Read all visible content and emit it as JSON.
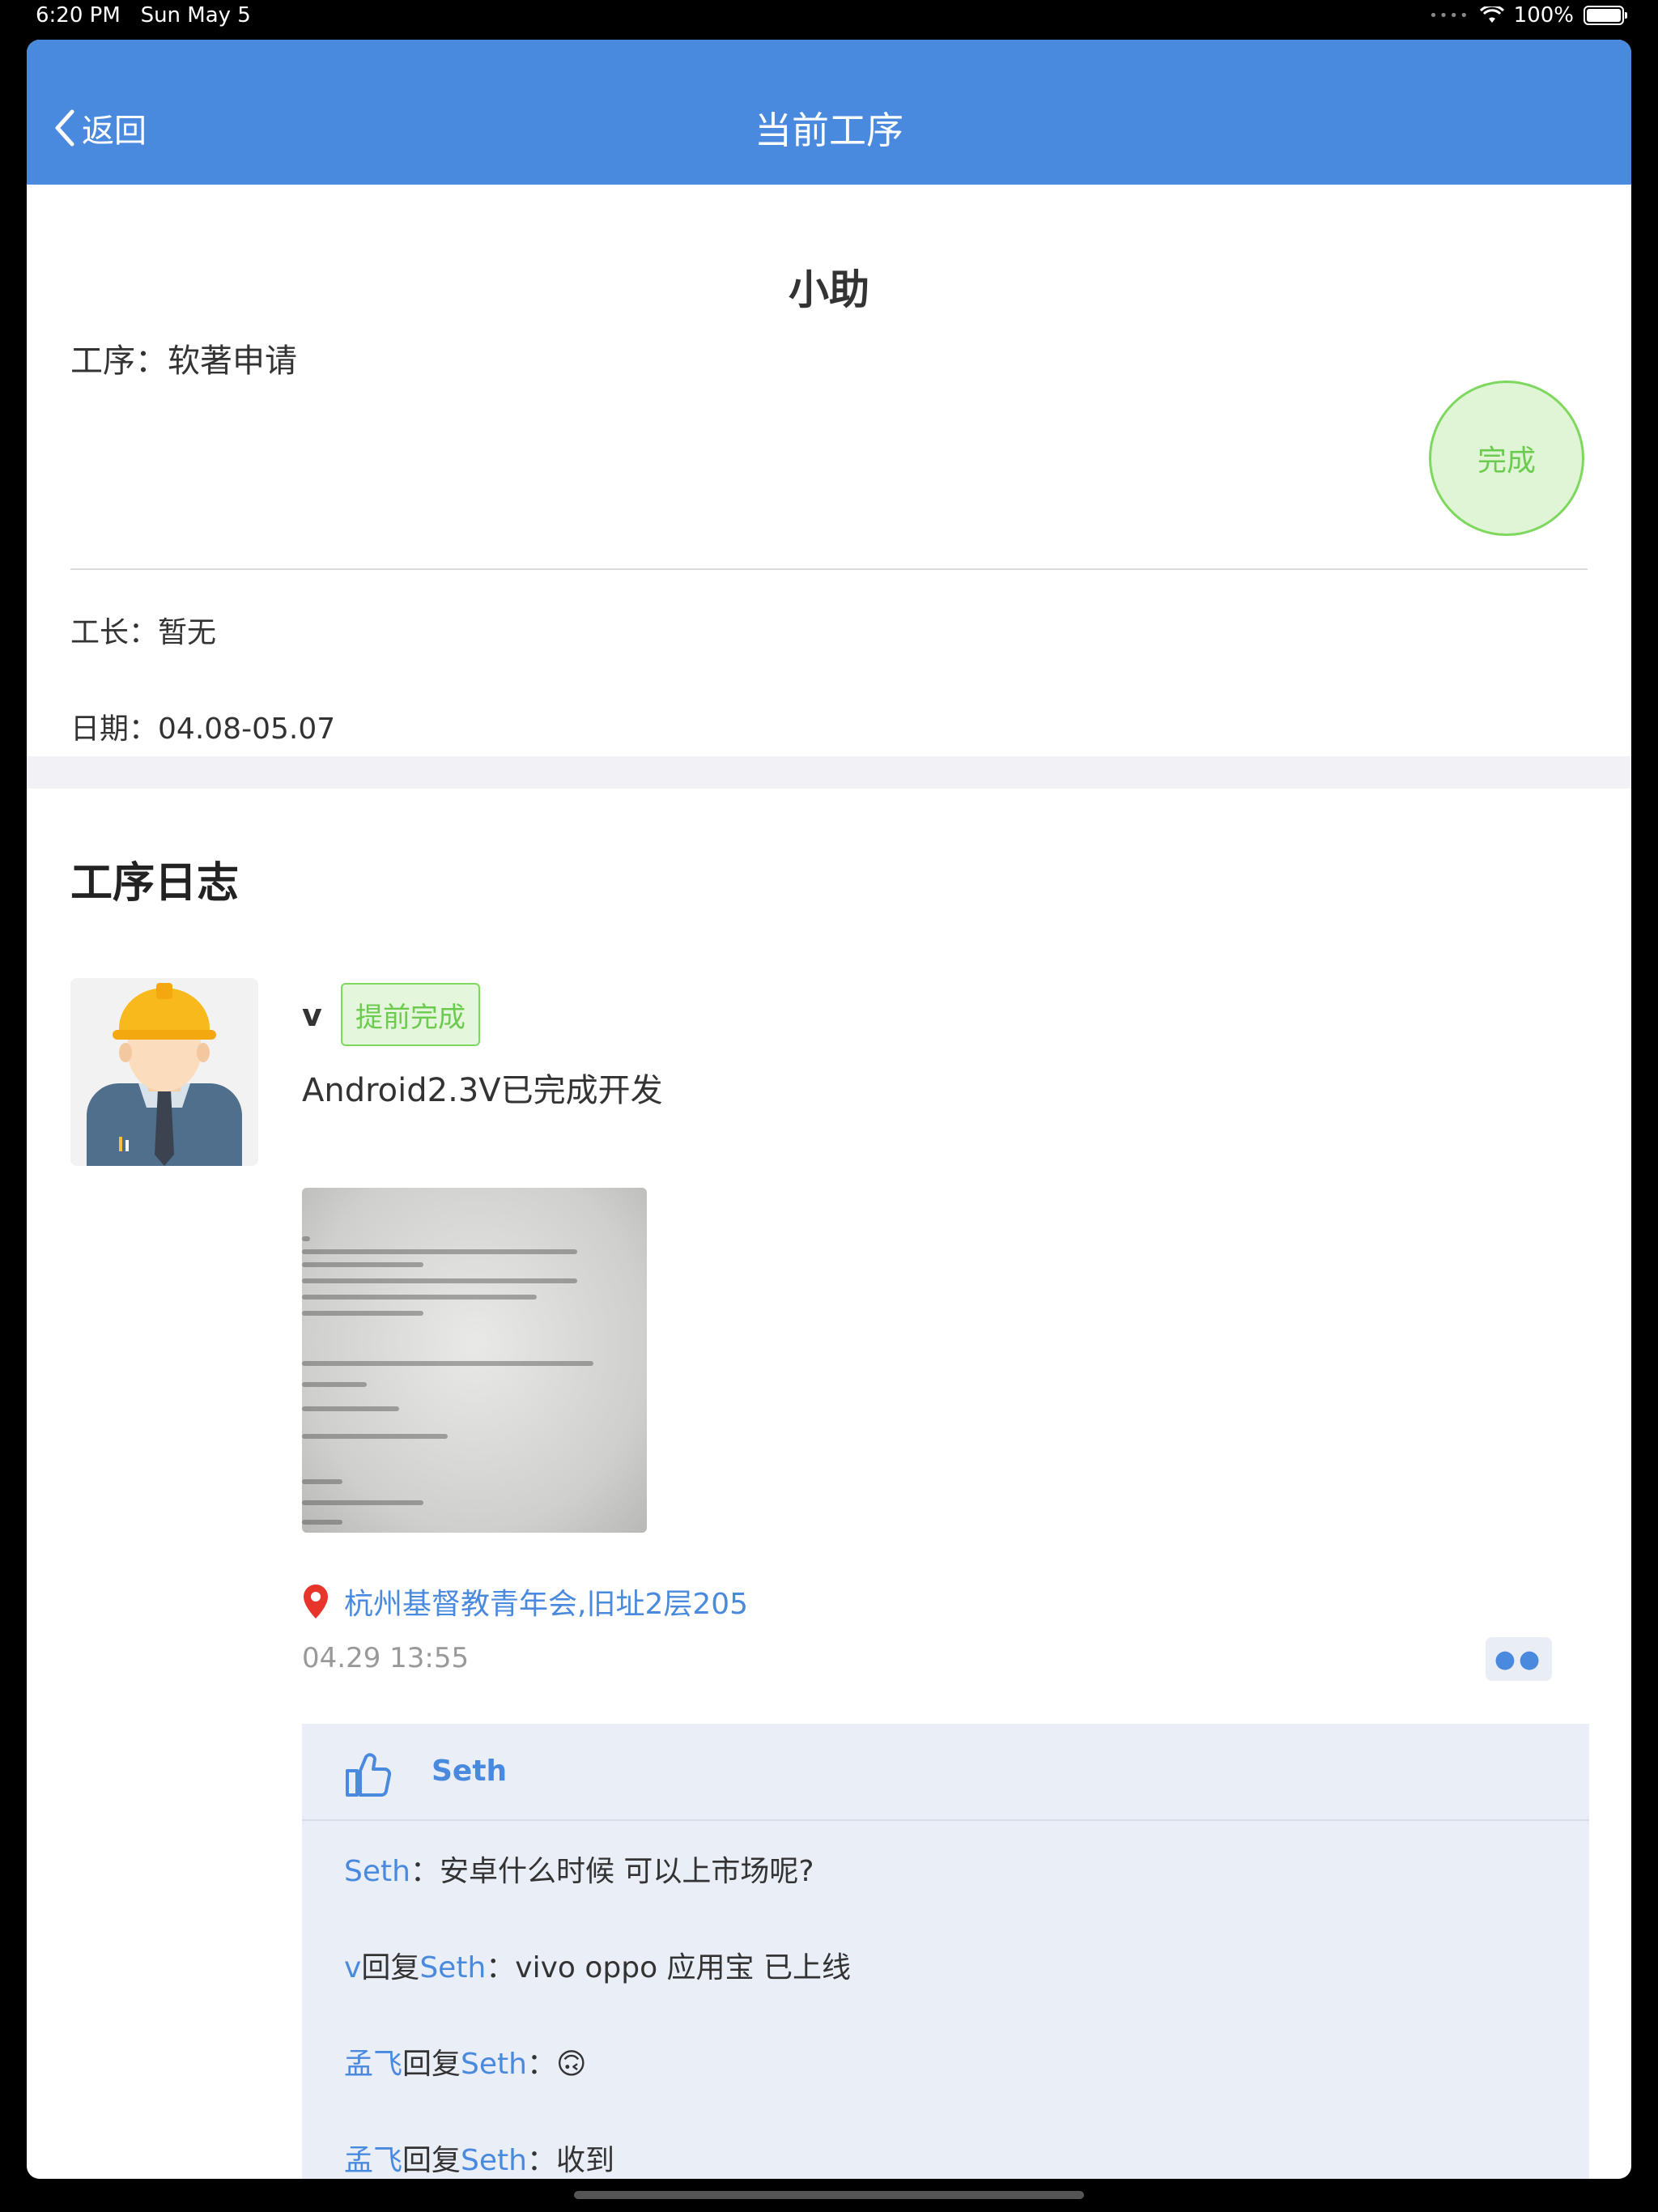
{
  "status": {
    "time": "6:20 PM",
    "date": "Sun May 5",
    "battery": "100%"
  },
  "nav": {
    "back": "返回",
    "title": "当前工序"
  },
  "header": {
    "title": "小助",
    "process_label": "工序：",
    "process_value": "软著申请",
    "complete_button": "完成",
    "leader_label": "工长：",
    "leader_value": "暂无",
    "date_label": "日期：",
    "date_value": "04.08-05.07"
  },
  "log": {
    "title": "工序日志",
    "entries": [
      {
        "user": "v",
        "badge": "提前完成",
        "text": "Android2.3V已完成开发",
        "location": "杭州基督教青年会,旧址2层205",
        "time": "04.29 13:55",
        "likes": "Seth",
        "comments": [
          {
            "from": "Seth",
            "reply_word": "",
            "to": "",
            "sep": "：",
            "text": "安卓什么时候 可以上市场呢?"
          },
          {
            "from": "v",
            "reply_word": "回复",
            "to": "Seth",
            "sep": "：",
            "text": "vivo oppo 应用宝 已上线"
          },
          {
            "from": "孟飞",
            "reply_word": "回复",
            "to": "Seth",
            "sep": "：",
            "text": "🙃"
          },
          {
            "from": "孟飞",
            "reply_word": "回复",
            "to": "Seth",
            "sep": "：",
            "text": "收到"
          }
        ]
      }
    ]
  },
  "colors": {
    "brand": "#4a8ade",
    "success": "#6ccb4f",
    "success_bg": "#dff5d6"
  },
  "icons": {
    "back": "chevron-left-icon",
    "location": "map-pin-icon",
    "like": "thumbs-up-icon",
    "more": "more-dots-icon"
  }
}
